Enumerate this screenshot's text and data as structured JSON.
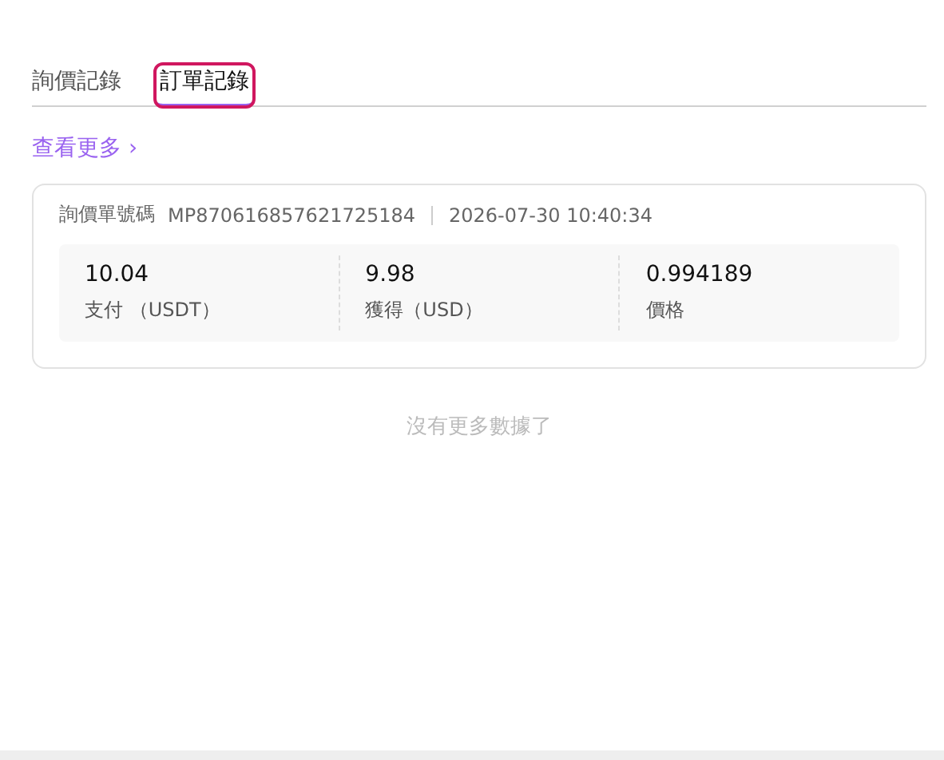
{
  "tabs": [
    {
      "label": "詢價記錄",
      "selected": false,
      "focused": false
    },
    {
      "label": "訂單記錄",
      "selected": true,
      "focused": true
    }
  ],
  "more_link": {
    "label": "查看更多",
    "icon": "›"
  },
  "orders": [
    {
      "id_label": "詢價單號碼",
      "id": "MP870616857621725184",
      "time": "2026-07-30 10:40:34",
      "stats": [
        {
          "value": "10.04",
          "label": "支付 （USDT）"
        },
        {
          "value": "9.98",
          "label": "獲得（USD）"
        },
        {
          "value": "0.994189",
          "label": "價格"
        }
      ]
    }
  ],
  "end_message": "沒有更多數據了"
}
